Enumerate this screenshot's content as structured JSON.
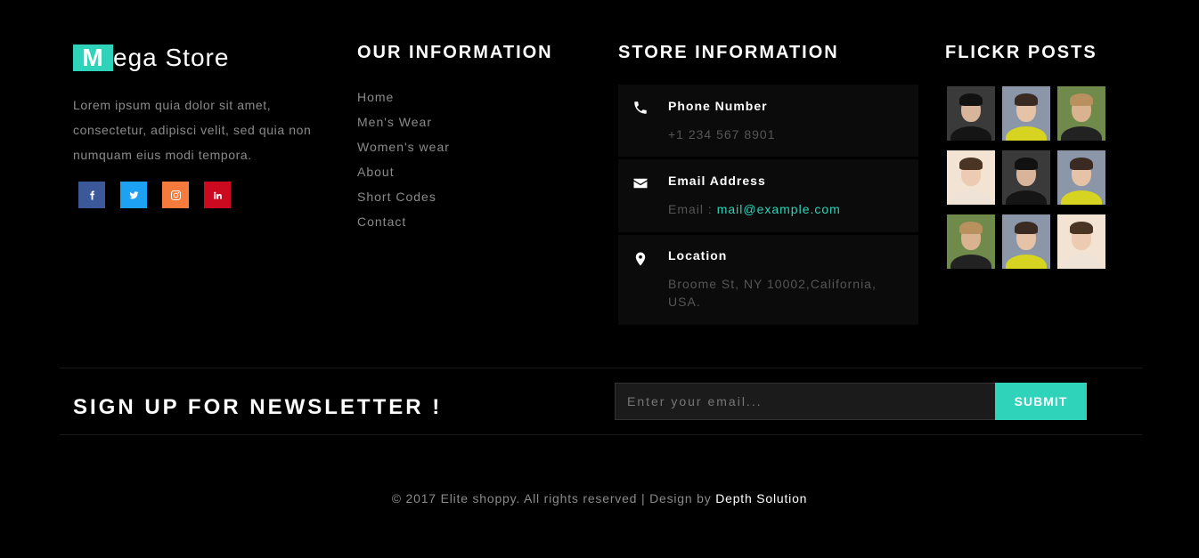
{
  "brand": {
    "logo_initial": "M",
    "logo_rest": "ega Store",
    "accent_color": "#2fd3b9"
  },
  "about": {
    "text": "Lorem ipsum quia dolor sit amet, consectetur, adipisci velit, sed quia non numquam eius modi tempora."
  },
  "socials": [
    {
      "name": "facebook",
      "icon": "facebook-icon",
      "color": "#3b5998"
    },
    {
      "name": "twitter",
      "icon": "twitter-icon",
      "color": "#1da1f2"
    },
    {
      "name": "instagram",
      "icon": "instagram-icon",
      "color": "#f47b3b"
    },
    {
      "name": "linkedin",
      "icon": "linkedin-icon",
      "color": "#cc0a1f"
    }
  ],
  "our_information": {
    "heading_bold": "OUR",
    "heading_rest": " INFORMATION",
    "links": [
      "Home",
      "Men's Wear",
      "Women's wear",
      "About",
      "Short Codes",
      "Contact"
    ]
  },
  "store_information": {
    "heading_bold": "STORE",
    "heading_rest": " INFORMATION",
    "phone": {
      "title": "Phone Number",
      "value": "+1 234 567 8901",
      "icon": "phone-icon"
    },
    "email": {
      "title": "Email Address",
      "prefix": "Email : ",
      "value": "mail@example.com",
      "icon": "envelope-icon"
    },
    "location": {
      "title": "Location",
      "value": "Broome St, NY 10002,California, USA.",
      "icon": "map-pin-icon"
    }
  },
  "flickr": {
    "heading_bold": "FLICKR",
    "heading_rest": " POSTS",
    "photos": [
      {
        "bg": "#3a3a3a",
        "skin": "#d8b49a",
        "hair": "#111111",
        "cloth": "#151515"
      },
      {
        "bg": "#8b96a8",
        "skin": "#e6c2a6",
        "hair": "#3b2a22",
        "cloth": "#d6d321"
      },
      {
        "bg": "#6f8a4a",
        "skin": "#d9b28f",
        "hair": "#b8915f",
        "cloth": "#222222"
      },
      {
        "bg": "#f3e3d3",
        "skin": "#edcbb2",
        "hair": "#4a3424",
        "cloth": "#efe2d6"
      },
      {
        "bg": "#3a3a3a",
        "skin": "#d8b49a",
        "hair": "#111111",
        "cloth": "#151515"
      },
      {
        "bg": "#8b96a8",
        "skin": "#e6c2a6",
        "hair": "#3b2a22",
        "cloth": "#d6d321"
      },
      {
        "bg": "#6f8a4a",
        "skin": "#d9b28f",
        "hair": "#b8915f",
        "cloth": "#222222"
      },
      {
        "bg": "#8b96a8",
        "skin": "#e6c2a6",
        "hair": "#3b2a22",
        "cloth": "#d6d321"
      },
      {
        "bg": "#f3e3d3",
        "skin": "#edcbb2",
        "hair": "#4a3424",
        "cloth": "#efe2d6"
      }
    ]
  },
  "newsletter": {
    "title": "SIGN UP FOR NEWSLETTER !",
    "placeholder": "Enter your email...",
    "button": "SUBMIT"
  },
  "footer": {
    "copyright": "© 2017 Elite shoppy. All rights reserved | Design by ",
    "designer": "Depth Solution"
  }
}
